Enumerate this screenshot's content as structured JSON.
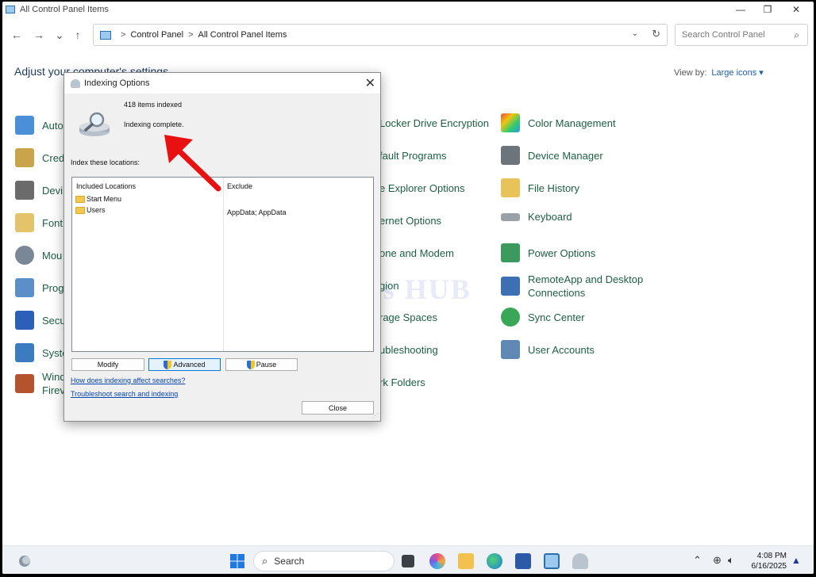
{
  "window": {
    "title": "All Control Panel Items",
    "minimize": "—",
    "maximize": "❐",
    "close": "✕"
  },
  "nav": {
    "back": "←",
    "forward": "→",
    "recent": "⌄",
    "up": "↑"
  },
  "address": {
    "crumbs": [
      "Control Panel",
      "All Control Panel Items"
    ],
    "separator": ">",
    "dropdown": "⌄",
    "refresh": "↻"
  },
  "search": {
    "placeholder": "Search Control Panel",
    "icon": "⌕"
  },
  "heading": "Adjust your computer's settings",
  "view_by": {
    "label": "View by:",
    "value": "Large icons ▾"
  },
  "items": {
    "col1": [
      "Auto",
      "Cred",
      "Devi",
      "Font",
      "Mou",
      "Prog",
      "Secu",
      "Syste",
      "Windows Defender Firewall"
    ],
    "col1_lines": {
      "firewall_line1": "Wind",
      "firewall_line2": "Firev"
    },
    "col2": [
      "Locker Drive Encryption",
      "fault Programs",
      "e Explorer Options",
      "ernet Options",
      "one and Modem",
      "gion",
      "rage Spaces",
      "ubleshooting",
      "rk Folders"
    ],
    "col3": [
      "Color Management",
      "Device Manager",
      "File History",
      "Keyboard",
      "Power Options",
      "RemoteApp and Desktop Connections",
      "Sync Center",
      "User Accounts"
    ],
    "col3_lines": {
      "remote_line1": "RemoteApp and Desktop",
      "remote_line2": "Connections"
    }
  },
  "dialog": {
    "title": "Indexing Options",
    "close": "✕",
    "items_indexed": "418 items indexed",
    "status": "Indexing complete.",
    "index_label": "Index these locations:",
    "columns": {
      "included": "Included Locations",
      "exclude": "Exclude"
    },
    "locations": [
      {
        "name": "Start Menu",
        "exclude": ""
      },
      {
        "name": "Users",
        "exclude": "AppData; AppData"
      }
    ],
    "buttons": {
      "modify": "Modify",
      "advanced": "Advanced",
      "pause": "Pause",
      "close": "Close"
    },
    "links": {
      "how": "How does indexing affect searches?",
      "troubleshoot": "Troubleshoot search and indexing"
    }
  },
  "watermark": "IT Pros HUB",
  "taskbar": {
    "search": "Search",
    "tray_chevron": "⌃",
    "time": "4:08 PM",
    "date": "6/16/2025"
  },
  "colors": {
    "item_text": "#1c5f44",
    "link": "#0645ad",
    "accent": "#0078d7",
    "arrow": "#e81010"
  }
}
